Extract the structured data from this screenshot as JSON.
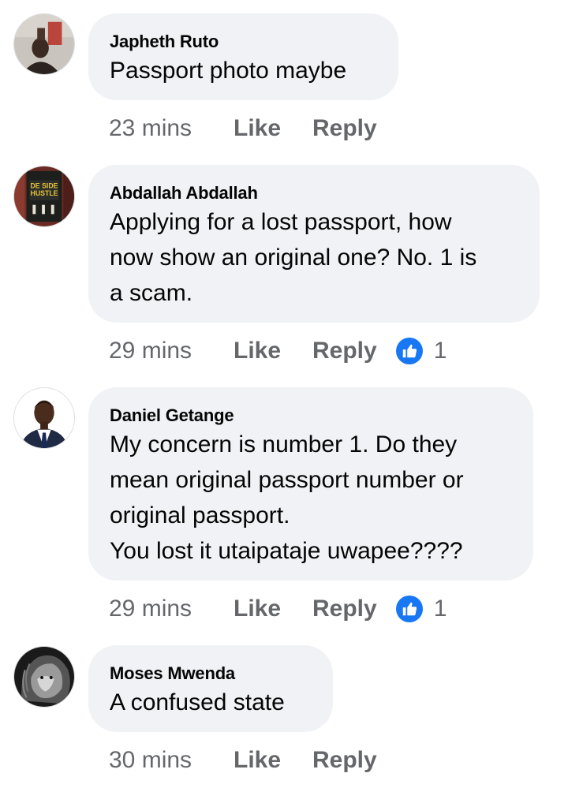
{
  "comments": [
    {
      "author": "Japheth Ruto",
      "text": "Passport photo maybe",
      "time": "23 mins",
      "like_label": "Like",
      "reply_label": "Reply",
      "reactions": null
    },
    {
      "author": "Abdallah Abdallah",
      "text": "Applying for a lost passport, how\nnow show an original one? No. 1 is\na scam.",
      "time": "29 mins",
      "like_label": "Like",
      "reply_label": "Reply",
      "reactions": "1",
      "avatar_text": "DE SIDE HUSTLE"
    },
    {
      "author": "Daniel Getange",
      "text": "My concern is number 1. Do they\nmean original passport number or\noriginal passport.\nYou lost it utaipataje uwapee????",
      "time": "29 mins",
      "like_label": "Like",
      "reply_label": "Reply",
      "reactions": "1"
    },
    {
      "author": "Moses Mwenda",
      "text": "A confused state",
      "time": "30 mins",
      "like_label": "Like",
      "reply_label": "Reply",
      "reactions": null
    }
  ],
  "colors": {
    "bubble": "#f0f2f5",
    "meta": "#65676b",
    "like_badge": "#1877f2"
  },
  "icons": {
    "reaction": "thumbs-up-icon"
  }
}
